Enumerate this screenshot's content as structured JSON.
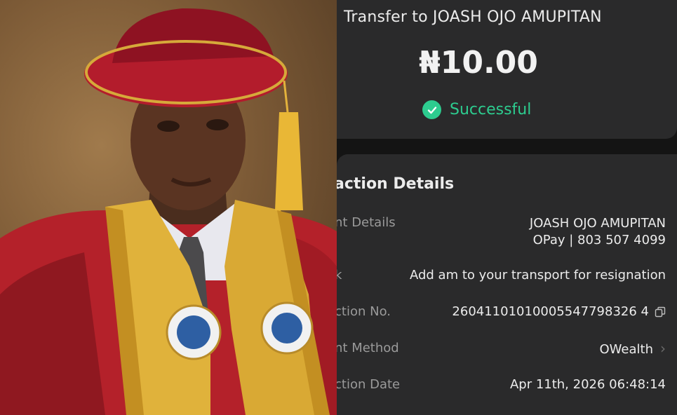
{
  "receipt": {
    "title": "Transfer to JOASH OJO AMUPITAN",
    "amount": "₦10.00",
    "status": "Successful",
    "status_color": "#2dcc8f",
    "section_title": "action Details",
    "rows": [
      {
        "label": "nt Details",
        "value": "JOASH OJO AMUPITAN",
        "value2": "OPay | 803 507 4099"
      },
      {
        "label": "k",
        "value": "Add am to your transport for resignation"
      },
      {
        "label": "ction No.",
        "value": "26041101010005547798326 4",
        "icon": "copy-icon"
      },
      {
        "label": "nt Method",
        "value": "OWealth",
        "icon": "chevron-right-icon"
      },
      {
        "label": "ction Date",
        "value": "Apr 11th, 2026 06:48:14"
      }
    ]
  }
}
